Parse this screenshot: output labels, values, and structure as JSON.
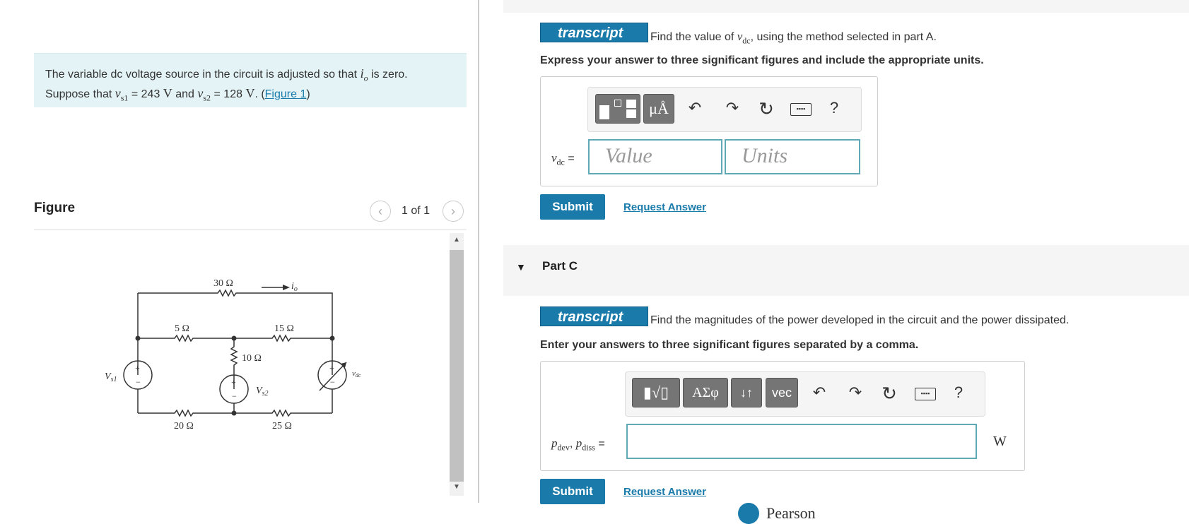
{
  "problem": {
    "text_1": "The variable dc voltage source in the circuit is adjusted so that ",
    "var_io": "i",
    "var_io_sub": "o",
    "text_2": " is zero.",
    "text_3": "Suppose that ",
    "var_vs1": "v",
    "var_vs1_sub": "s1",
    "text_4": " = 243 ",
    "unit_v1": "V",
    "text_5": " and ",
    "var_vs2": "v",
    "var_vs2_sub": "s2",
    "text_6": " = 128 ",
    "unit_v2": "V",
    "text_7": ". (",
    "figure_link": "Figure 1",
    "text_8": ")"
  },
  "figure": {
    "label": "Figure",
    "counter": "1 of 1",
    "prev_icon": "chevron-left-icon",
    "next_icon": "chevron-right-icon",
    "labels": {
      "r30": "30 Ω",
      "io": "i",
      "io_sub": "o",
      "r5": "5 Ω",
      "r15": "15 Ω",
      "r10": "10 Ω",
      "vs1": "V",
      "vs1_sub": "s1",
      "vs2": "V",
      "vs2_sub": "s2",
      "vdc": "v",
      "vdc_sub": "dc",
      "r20": "20 Ω",
      "r25": "25 Ω",
      "plus": "+",
      "minus": "−"
    }
  },
  "part_b": {
    "transcript_label": "transcript",
    "question": "Find the value of ",
    "question_var": "v",
    "question_var_sub": "dc",
    "question_end": ", using the method selected in part A.",
    "instructions": "Express your answer to three significant figures and include the appropriate units.",
    "answer_label_var": "v",
    "answer_label_sub": "dc",
    "answer_label_eq": " =",
    "value_placeholder": "Value",
    "units_placeholder": "Units",
    "toolbar": {
      "templates_icon": "templates-icon",
      "units_button": "μÅ",
      "undo_icon": "undo-icon",
      "redo_icon": "redo-icon",
      "reset_icon": "reset-icon",
      "keyboard_icon": "keyboard-icon",
      "help": "?"
    },
    "submit_label": "Submit",
    "request_label": "Request Answer"
  },
  "part_c": {
    "title": "Part C",
    "transcript_label": "transcript",
    "question": "Find the magnitudes of the power developed in the circuit and  the power dissipated.",
    "instructions": "Enter your answers to three significant figures separated by a comma.",
    "answer_label_var1": "p",
    "answer_label_sub1": "dev",
    "answer_label_sep": ", ",
    "answer_label_var2": "p",
    "answer_label_sub2": "diss",
    "answer_label_eq": " =",
    "unit": "W",
    "toolbar": {
      "templates_icon": "templates-sqrt-icon",
      "greek_button": "ΑΣφ",
      "arrows_button": "↓↑",
      "vec_button": "vec",
      "undo_icon": "undo-icon",
      "redo_icon": "redo-icon",
      "reset_icon": "reset-icon",
      "keyboard_icon": "keyboard-icon",
      "help": "?"
    },
    "submit_label": "Submit",
    "request_label": "Request Answer"
  },
  "footer": {
    "brand": "Pearson"
  }
}
